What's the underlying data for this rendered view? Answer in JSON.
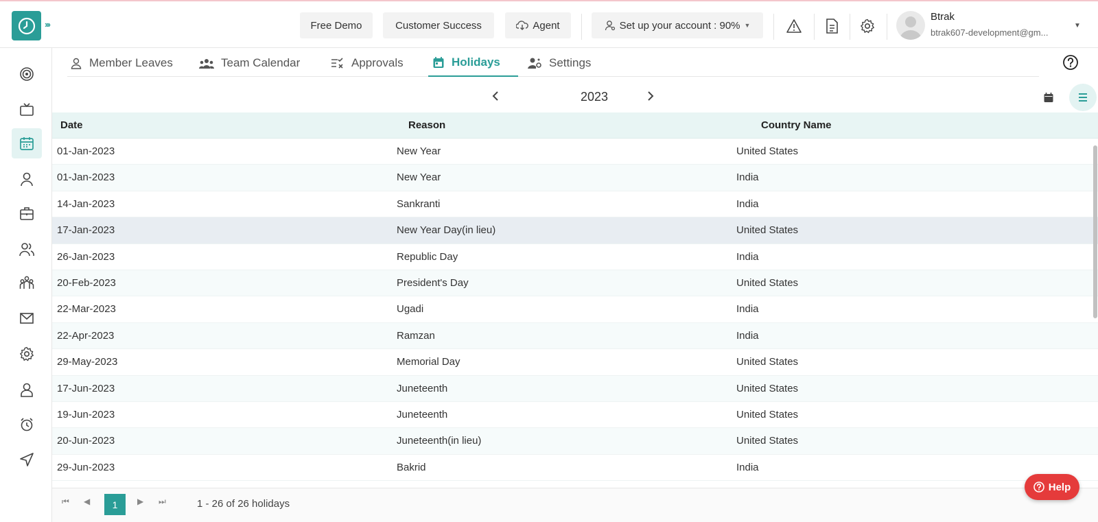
{
  "header": {
    "free_demo": "Free Demo",
    "customer_success": "Customer Success",
    "agent": "Agent",
    "setup": "Set up your account : 90%",
    "user_name": "Btrak",
    "user_email": "btrak607-development@gm..."
  },
  "tabs": [
    {
      "label": "Member Leaves",
      "icon": "user-icon"
    },
    {
      "label": "Team Calendar",
      "icon": "team-icon"
    },
    {
      "label": "Approvals",
      "icon": "approvals-icon"
    },
    {
      "label": "Holidays",
      "icon": "calendar-icon"
    },
    {
      "label": "Settings",
      "icon": "user-settings-icon"
    }
  ],
  "year": "2023",
  "table": {
    "headers": {
      "date": "Date",
      "reason": "Reason",
      "country": "Country Name"
    },
    "rows": [
      {
        "date": "01-Jan-2023",
        "reason": "New Year",
        "country": "United States"
      },
      {
        "date": "01-Jan-2023",
        "reason": "New Year",
        "country": "India"
      },
      {
        "date": "14-Jan-2023",
        "reason": "Sankranti",
        "country": "India"
      },
      {
        "date": "17-Jan-2023",
        "reason": "New Year Day(in lieu)",
        "country": "United States"
      },
      {
        "date": "26-Jan-2023",
        "reason": "Republic Day",
        "country": "India"
      },
      {
        "date": "20-Feb-2023",
        "reason": "President's Day",
        "country": "United States"
      },
      {
        "date": "22-Mar-2023",
        "reason": "Ugadi",
        "country": "India"
      },
      {
        "date": "22-Apr-2023",
        "reason": "Ramzan",
        "country": "India"
      },
      {
        "date": "29-May-2023",
        "reason": "Memorial Day",
        "country": "United States"
      },
      {
        "date": "17-Jun-2023",
        "reason": "Juneteenth",
        "country": "United States"
      },
      {
        "date": "19-Jun-2023",
        "reason": "Juneteenth",
        "country": "United States"
      },
      {
        "date": "20-Jun-2023",
        "reason": "Juneteenth(in lieu)",
        "country": "United States"
      },
      {
        "date": "29-Jun-2023",
        "reason": "Bakrid",
        "country": "India"
      }
    ]
  },
  "pager": {
    "current": "1",
    "info": "1 - 26 of 26 holidays"
  },
  "help": "Help",
  "colors": {
    "accent": "#2a9d97",
    "help": "#e53b3b",
    "header_bg": "#e8f5f4"
  }
}
